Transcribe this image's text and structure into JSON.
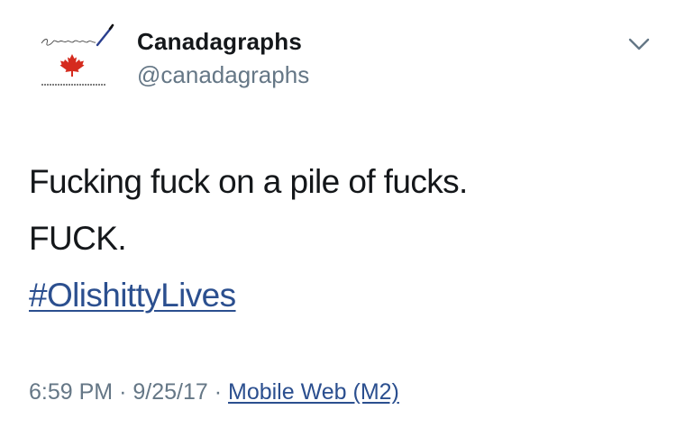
{
  "header": {
    "display_name": "Canadagraphs",
    "handle": "@canadagraphs",
    "avatar_signature": "Canadagraphs",
    "avatar_url_text": "http://canadagraphs.weebly.com",
    "menu_icon": "chevron-down-icon"
  },
  "tweet": {
    "lines": [
      "Fucking fuck on a pile of fucks.",
      "FUCK."
    ],
    "hashtag": "#OlishittyLives"
  },
  "meta": {
    "time": "6:59 PM",
    "separator": "·",
    "date": "9/25/17",
    "source": "Mobile Web (M2)"
  },
  "colors": {
    "text": "#14171a",
    "secondary": "#657786",
    "link": "#2b4f8f",
    "maple_leaf": "#d52b1e"
  }
}
